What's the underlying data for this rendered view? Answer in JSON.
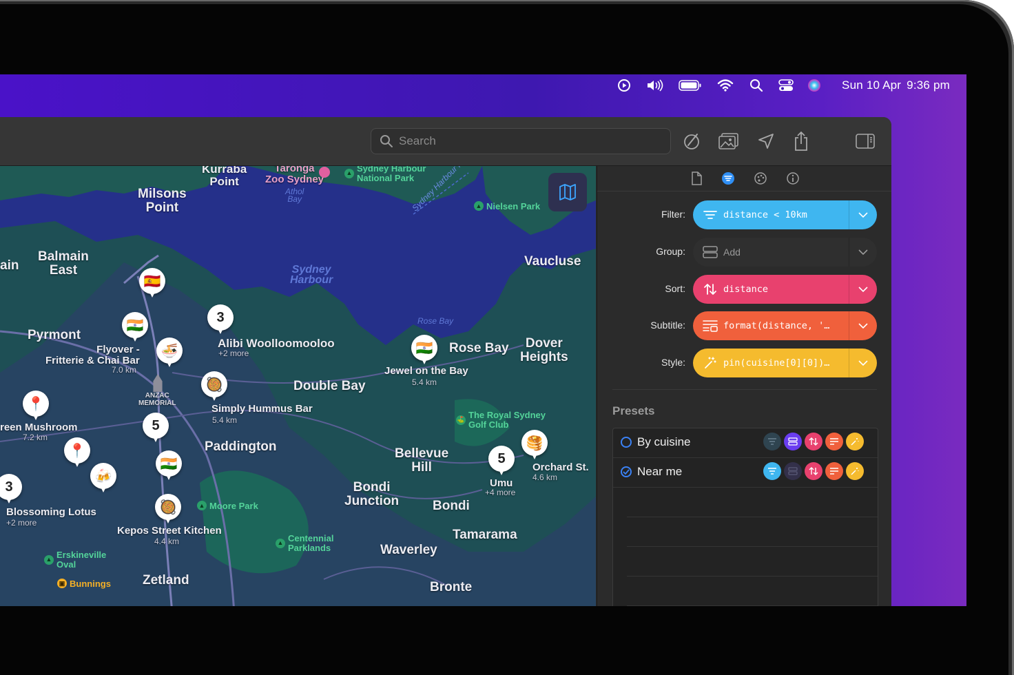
{
  "menubar": {
    "date": "Sun 10 Apr",
    "time": "9:36 pm",
    "icons": [
      "play-circle-icon",
      "volume-icon",
      "battery-icon",
      "wifi-icon",
      "search-icon",
      "control-center-icon",
      "siri-icon"
    ]
  },
  "toolbar": {
    "search_placeholder": "Search",
    "icons": [
      "compass-edit-icon",
      "photo-gallery-icon",
      "location-arrow-icon",
      "share-icon",
      "sidebar-toggle-icon"
    ]
  },
  "map": {
    "labels": {
      "kurraba": "Kurraba\nPoint",
      "taronga": "Taronga\nZoo Sydney",
      "harbour_np": "Sydney Harbour\nNational Park",
      "milsons": "Milsons\nPoint",
      "athol": "Athol\nBay",
      "ferry": "Sydney Harbour Fer",
      "nielsen": "Nielsen Park",
      "balmain_east": "Balmain\nEast",
      "balmain": "ain",
      "sydney_harbour": "Sydney\nHarbour",
      "vaucluse": "Vaucluse",
      "rose_bay_water": "Rose Bay",
      "pyrmont": "Pyrmont",
      "flyover": "Flyover -\nFritterie & Chai Bar",
      "flyover_dist": "7.0 km",
      "alibi": "Alibi Woolloomooloo",
      "alibi_more": "+2 more",
      "rose_bay": "Rose Bay",
      "dover": "Dover\nHeights",
      "jewel": "Jewel on the Bay",
      "jewel_dist": "5.4 km",
      "double_bay": "Double Bay",
      "anzac": "ANZAC\nMEMORIAL",
      "green_mushroom": "reen Mushroom",
      "green_dist": "7.2 km",
      "simply_hummus": "Simply Hummus Bar",
      "hummus_dist": "5.4 km",
      "golf": "The Royal Sydney\nGolf Club",
      "paddington": "Paddington",
      "bellevue": "Bellevue\nHill",
      "orchard": "Orchard St.",
      "orchard_dist": "4.6 km",
      "umu": "Umu",
      "umu_more": "+4 more",
      "blossoming": "Blossoming Lotus",
      "blossoming_more": "+2 more",
      "moore_park": "Moore Park",
      "bondi_junction": "Bondi\nJunction",
      "bondi": "Bondi",
      "kepos": "Kepos Street Kitchen",
      "kepos_dist": "4.4 km",
      "tamarama": "Tamarama",
      "centennial": "Centennial\nParklands",
      "waverley": "Waverley",
      "erskineville": "Erskineville\nOval",
      "bunnings": "Bunnings",
      "zetland": "Zetland",
      "bronte": "Bronte"
    },
    "cluster_counts": [
      "3",
      "5",
      "5",
      "3"
    ]
  },
  "panel": {
    "tabs": [
      "document-icon",
      "filter-list-icon",
      "palette-icon",
      "info-icon"
    ],
    "rows": [
      {
        "label": "Filter:",
        "value": "distance < 10km",
        "color": "#3fb6f0",
        "text_color": "#ffffff"
      },
      {
        "label": "Group:",
        "value": "Add",
        "color": "#2f2f2f",
        "text_color": "#9a9a9a"
      },
      {
        "label": "Sort:",
        "value": "distance",
        "color": "#e8416e",
        "text_color": "#ffffff"
      },
      {
        "label": "Subtitle:",
        "value": "format(distance, '…",
        "color": "#f0603c",
        "text_color": "#ffffff"
      },
      {
        "label": "Style:",
        "value": "pin(cuisine[0][0])…",
        "color": "#f5bb2e",
        "text_color": "#ffffff"
      }
    ],
    "presets_title": "Presets",
    "presets": [
      {
        "name": "By cuisine",
        "checked": false
      },
      {
        "name": "Near me",
        "checked": true
      }
    ]
  }
}
